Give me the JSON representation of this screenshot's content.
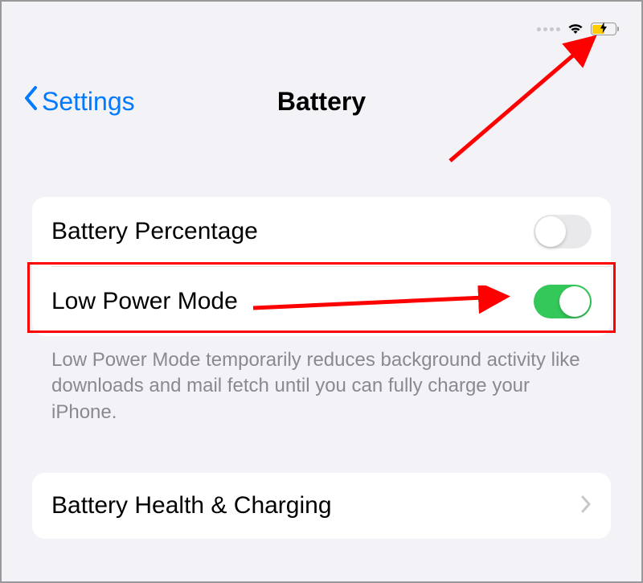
{
  "statusBar": {
    "batteryCharging": true
  },
  "nav": {
    "backLabel": "Settings",
    "title": "Battery"
  },
  "rows": {
    "batteryPercentage": {
      "label": "Battery Percentage",
      "on": false
    },
    "lowPowerMode": {
      "label": "Low Power Mode",
      "on": true
    },
    "footer": "Low Power Mode temporarily reduces background activity like downloads and mail fetch until you can fully charge your iPhone.",
    "batteryHealth": {
      "label": "Battery Health & Charging"
    }
  }
}
